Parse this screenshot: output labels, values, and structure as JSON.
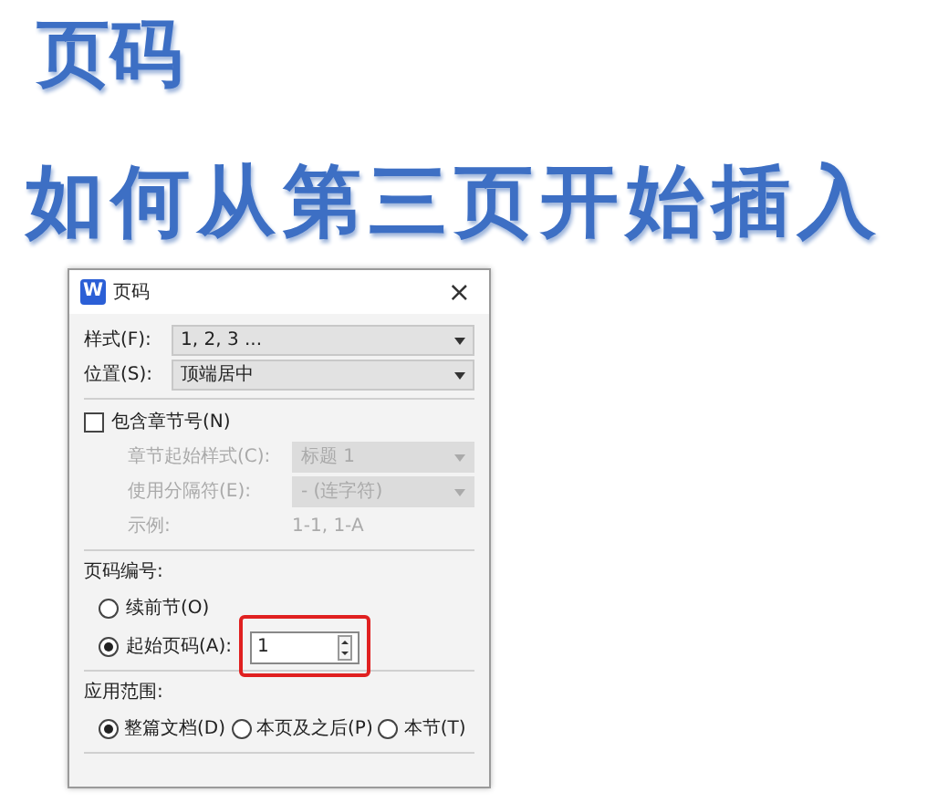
{
  "title": "页码",
  "subtitle": "如何从第三页开始插入",
  "dialog": {
    "app_icon": "W",
    "title": "页码",
    "close": "×",
    "fields": [
      {
        "label": "样式(F):",
        "value": "1, 2, 3 ...",
        "disabled": false
      },
      {
        "label": "位置(S):",
        "value": "顶端居中",
        "disabled": false
      }
    ],
    "include_chapter": {
      "label": "包含章节号(N)",
      "checked": false
    },
    "chapter_fields": [
      {
        "label": "章节起始样式(C):",
        "value": "标题 1",
        "disabled": true
      },
      {
        "label": "使用分隔符(E):",
        "value": "-   (连字符)",
        "disabled": true
      }
    ],
    "example": {
      "label": "示例:",
      "value": "1-1, 1-A",
      "disabled": true
    },
    "numbering": {
      "heading": "页码编号:",
      "options": [
        {
          "label": "续前节(O)",
          "selected": false
        },
        {
          "label": "起始页码(A):",
          "selected": true
        }
      ],
      "start_value": "1",
      "highlighted": true
    },
    "apply": {
      "heading": "应用范围:",
      "options": [
        {
          "label": "整篇文档(D)",
          "selected": true
        },
        {
          "label": "本页及之后(P)",
          "selected": false
        },
        {
          "label": "本节(T)",
          "selected": false
        }
      ]
    }
  }
}
